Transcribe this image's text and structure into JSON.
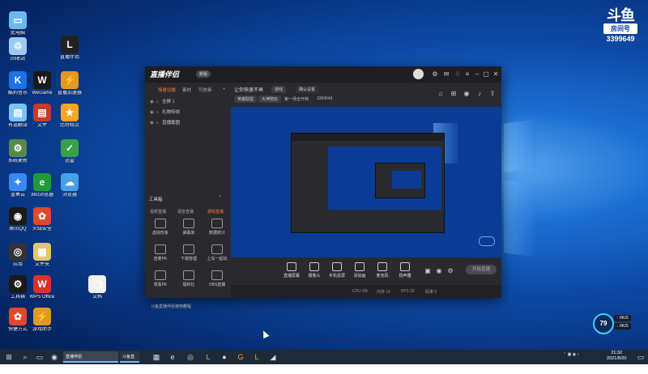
{
  "desktop": {
    "icons": [
      {
        "label": "此电脑",
        "glyph": "▭",
        "color": "#6bb8f0"
      },
      {
        "label": "回收站",
        "glyph": "♲",
        "color": "#9ecbf0"
      },
      {
        "label": "酷狗音乐",
        "glyph": "K",
        "color": "#1a73e8"
      },
      {
        "label": "有道翻译",
        "glyph": "▤",
        "color": "#7bc4f8"
      },
      {
        "label": "系统更新",
        "glyph": "⚙",
        "color": "#5a8a4a"
      },
      {
        "label": "蓝奏云",
        "glyph": "✦",
        "color": "#3a88f0"
      },
      {
        "label": "腾讯QQ",
        "glyph": "◉",
        "color": "#1a1a1a"
      },
      {
        "label": "直播伴侣",
        "glyph": "L",
        "color": "#222"
      },
      {
        "label": "直播加速器",
        "glyph": "⚡",
        "color": "#e09a20"
      },
      {
        "label": "WeGame",
        "glyph": "W",
        "color": "#1a1a1a"
      },
      {
        "label": "比特精灵",
        "glyph": "★",
        "color": "#f5a623"
      },
      {
        "label": "文件",
        "glyph": "▤",
        "color": "#c43b2b"
      },
      {
        "label": "迅雷",
        "glyph": "✓",
        "color": "#3aa04a"
      },
      {
        "label": "浏览器",
        "glyph": "☁",
        "color": "#45a0e8"
      },
      {
        "label": "360浏览器",
        "glyph": "e",
        "color": "#1c9c3a"
      },
      {
        "label": "火绒安全",
        "glyph": "✿",
        "color": "#e0482a"
      },
      {
        "label": "文件夹",
        "glyph": "▦",
        "color": "#e7c66a"
      },
      {
        "label": "WPS Office",
        "glyph": "W",
        "color": "#d8332a"
      },
      {
        "label": "文档",
        "glyph": "▢",
        "color": "#f0f0f0"
      },
      {
        "label": "工具箱",
        "glyph": "⚙",
        "color": "#1a1a1a"
      },
      {
        "label": "游戏助手",
        "glyph": "⚡",
        "color": "#e09a20"
      },
      {
        "label": "快捷方式",
        "glyph": "✿",
        "color": "#e0482a"
      },
      {
        "label": "应用",
        "glyph": "◎",
        "color": "#333"
      }
    ]
  },
  "brand_logo": {
    "text": "斗鱼",
    "tag": "房间号",
    "room": "3399649"
  },
  "app": {
    "title": "直播伴侣",
    "version": "新版",
    "left_tabs": [
      "场景切换",
      "素材",
      "可放素",
      "+"
    ],
    "scenes": [
      "全屏 1",
      "礼物特效",
      "直播截图"
    ],
    "tools_title": "工具箱",
    "modes": [
      "视频直播",
      "语音直播",
      "游戏直播"
    ],
    "tools": [
      {
        "label": "虚拟形象"
      },
      {
        "label": "弹幕库"
      },
      {
        "label": "数据统计"
      },
      {
        "label": "连麦PK"
      },
      {
        "label": "下载管理"
      },
      {
        "label": "上车一起玩"
      },
      {
        "label": "观看PK"
      },
      {
        "label": "福利社"
      },
      {
        "label": "OBS直播"
      }
    ],
    "room_title": "让你快速不再",
    "room_chips": [
      "游戏",
      "确认设置"
    ],
    "room_info": [
      "英雄联盟",
      "大神陪玩",
      "第一场全开档",
      "3399649"
    ],
    "bottom_buttons": [
      {
        "label": "直播屏幕"
      },
      {
        "label": "摄像头"
      },
      {
        "label": "手机投屏"
      },
      {
        "label": "添加画"
      },
      {
        "label": "麦克风"
      },
      {
        "label": "扬声器"
      }
    ],
    "start_button": "开始直播",
    "hint": "斗鱼直播伴侣使用教程",
    "status": [
      "CPU 0%",
      "内存 19",
      "FPS 30",
      "码率 0"
    ]
  },
  "widget": {
    "value": "79",
    "up": "↑ 0K/S",
    "down": "↓ 0K/S"
  },
  "taskbar": {
    "tasks": [
      "直播伴侣",
      "斗鱼直播"
    ],
    "time": "21:32",
    "date": "2021/8/20"
  }
}
